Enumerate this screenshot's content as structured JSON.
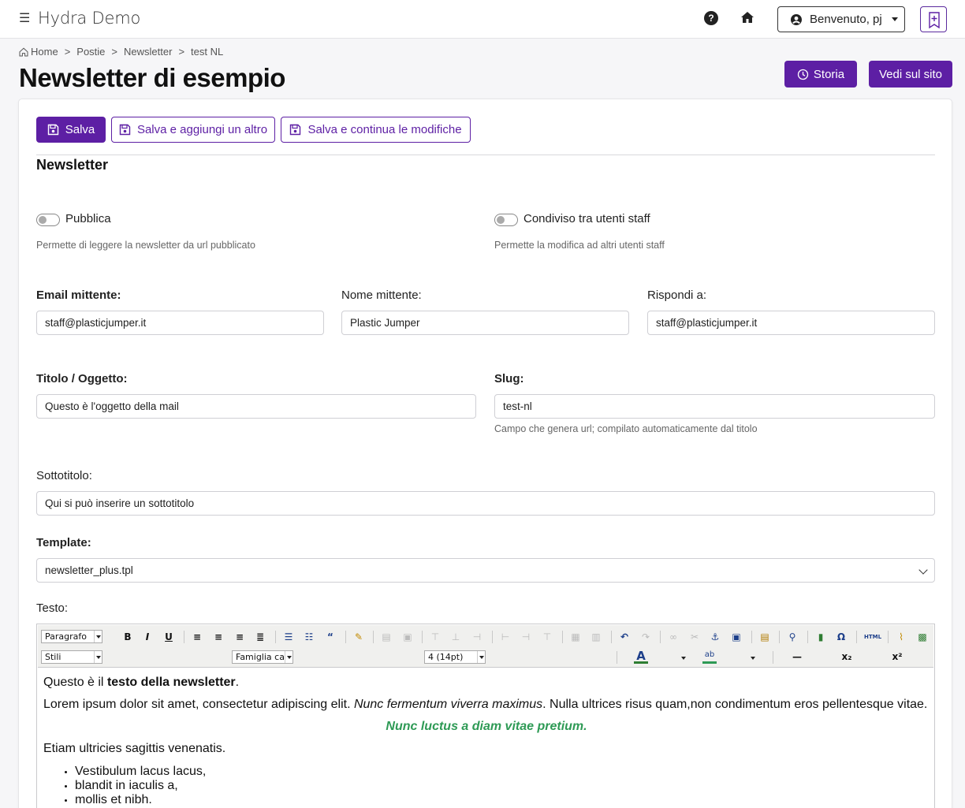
{
  "header": {
    "brand": "Hydra Demo",
    "user_label": "Benvenuto, pj"
  },
  "breadcrumb": [
    "Home",
    "Postie",
    "Newsletter",
    "test NL"
  ],
  "page": {
    "title": "Newsletter di esempio",
    "storia_label": "Storia",
    "vedi_label": "Vedi sul sito"
  },
  "actions": {
    "salva": "Salva",
    "salva_aggiungi": "Salva e aggiungi un altro",
    "salva_continua": "Salva e continua le modifiche"
  },
  "form": {
    "section": "Newsletter",
    "pubblica_label": "Pubblica",
    "pubblica_help": "Permette di leggere la newsletter da url pubblicato",
    "condiviso_label": "Condiviso tra utenti staff",
    "condiviso_help": "Permette la modifica ad altri utenti staff",
    "email_label": "Email mittente:",
    "email_value": "staff@plasticjumper.it",
    "nome_label": "Nome mittente:",
    "nome_value": "Plastic Jumper",
    "rispondi_label": "Rispondi a:",
    "rispondi_value": "staff@plasticjumper.it",
    "titolo_label": "Titolo / Oggetto:",
    "titolo_value": "Questo è l'oggetto della mail",
    "slug_label": "Slug:",
    "slug_value": "test-nl",
    "slug_help": "Campo che genera url; compilato automaticamente dal titolo",
    "sottotitolo_label": "Sottotitolo:",
    "sottotitolo_value": "Qui si può inserire un sottotitolo",
    "template_label": "Template:",
    "template_value": "newsletter_plus.tpl",
    "testo_label": "Testo:"
  },
  "editor": {
    "format_select": "Paragrafo",
    "styles_select": "Stili",
    "font_select": "Famiglia cara",
    "size_select": "4 (14pt)",
    "html_button": "HTML",
    "content": {
      "p1_pre": "Questo è il ",
      "p1_bold": "testo della newsletter",
      "p1_post": ".",
      "p2_pre": "Lorem ipsum dolor sit amet, consectetur adipiscing elit. ",
      "p2_italic": "Nunc fermentum viverra maximus",
      "p2_post": ". Nulla ultrices risus quam,non condimentum eros pellentesque vitae.",
      "p3": "Nunc luctus a diam vitae pretium.",
      "p4": "Etiam ultricies sagittis venenatis.",
      "list": [
        "Vestibulum lacus lacus,",
        "blandit in iaculis a,",
        "mollis et nibh."
      ]
    }
  }
}
